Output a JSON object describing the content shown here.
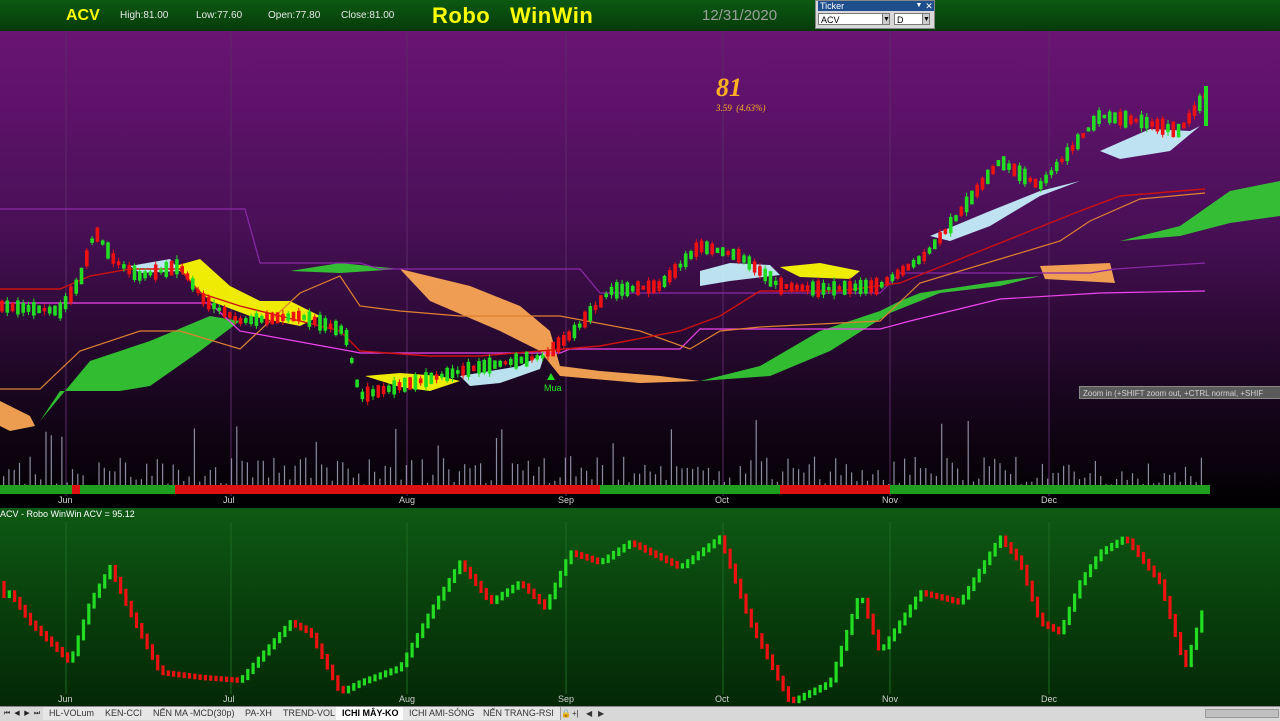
{
  "header": {
    "symbol": "ACV",
    "high": "High:81.00",
    "low": "Low:77.60",
    "open": "Open:77.80",
    "close": "Close:81.00",
    "brand": "Robo   WinWin",
    "date": "12/31/2020"
  },
  "ticker_panel": {
    "title": "Ticker",
    "symbol_value": "ACV",
    "period_value": "D",
    "dropdown_icon": "chevron-down-icon",
    "close_icon": "close-icon"
  },
  "price_chart": {
    "last_price": "81",
    "change": "3.59  (4.63%)",
    "signal_label": "Mua",
    "zoom_tip": "Zoom in (+SHIFT zoom out, +CTRL normal, +SHIF",
    "months": [
      "Jun",
      "Jul",
      "Aug",
      "Sep",
      "Oct",
      "Nov",
      "Dec"
    ]
  },
  "indicator": {
    "title": "ACV - Robo WinWin ACV = 95.12",
    "months": [
      "Jun",
      "Jul",
      "Aug",
      "Sep",
      "Oct",
      "Nov",
      "Dec"
    ]
  },
  "tabs": {
    "items": [
      {
        "label": "HL-VOLum"
      },
      {
        "label": "KEN-CCI"
      },
      {
        "label": "NẾN MA -MCD(30p)"
      },
      {
        "label": "PA-XH"
      },
      {
        "label": "TREND-VOL"
      },
      {
        "label": "ICHI MÂY-KO"
      },
      {
        "label": "ICHI AMI-SÓNG"
      },
      {
        "label": "NẾN TRANG-RSI"
      }
    ],
    "active_index": 5,
    "nav_icons": [
      "first-icon",
      "prev-icon",
      "next-icon",
      "last-icon"
    ]
  },
  "colors": {
    "bull": "#22dd22",
    "bear": "#ee1111",
    "cloud_green": "#33cc33",
    "cloud_orange": "#ffaa55",
    "cloud_yellow": "#ffff00",
    "cloud_cyan": "#c8f4ff",
    "brand_yellow": "#ffff00",
    "price_orange": "#ffb020"
  }
}
